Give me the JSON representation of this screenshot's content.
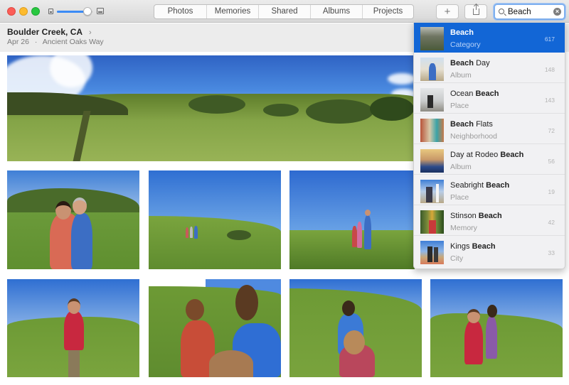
{
  "window": {
    "controls": [
      "close",
      "minimize",
      "maximize"
    ],
    "zoom_slider_value": 0.85
  },
  "toolbar": {
    "tabs": [
      {
        "label": "Photos",
        "active": true
      },
      {
        "label": "Memories",
        "active": false
      },
      {
        "label": "Shared",
        "active": false
      },
      {
        "label": "Albums",
        "active": false
      },
      {
        "label": "Projects",
        "active": false
      }
    ],
    "add_label": "+",
    "add_icon": "plus-icon",
    "share_icon": "share-icon",
    "search": {
      "value": "Beach",
      "icon": "magnifier-icon",
      "clear_icon": "clear-icon",
      "clear_glyph": "×"
    }
  },
  "header": {
    "title": "Boulder Creek, CA",
    "chevron": "›",
    "date": "Apr 26",
    "separator": "·",
    "location": "Ancient Oaks Way"
  },
  "photos": [
    {
      "description": "Panoramic grassy hillside with trail and blue sky"
    },
    {
      "description": "Couple embracing in grassy field"
    },
    {
      "description": "Group of hikers walking up grassy slope"
    },
    {
      "description": "Hikers walking through tall grass"
    },
    {
      "description": "Girl in red vest standing on hillside"
    },
    {
      "description": "Children with backpacks walking uphill"
    },
    {
      "description": "Girls walking up grassy hill"
    },
    {
      "description": "Two girls standing in grassy field"
    }
  ],
  "search_results": [
    {
      "prefix": "",
      "match": "Beach",
      "suffix": "",
      "type": "Category",
      "count": "617",
      "selected": true
    },
    {
      "prefix": "",
      "match": "Beach",
      "suffix": " Day",
      "type": "Album",
      "count": "148",
      "selected": false
    },
    {
      "prefix": "Ocean ",
      "match": "Beach",
      "suffix": "",
      "type": "Place",
      "count": "143",
      "selected": false
    },
    {
      "prefix": "",
      "match": "Beach",
      "suffix": " Flats",
      "type": "Neighborhood",
      "count": "72",
      "selected": false
    },
    {
      "prefix": "Day at Rodeo ",
      "match": "Beach",
      "suffix": "",
      "type": "Album",
      "count": "56",
      "selected": false
    },
    {
      "prefix": "Seabright ",
      "match": "Beach",
      "suffix": "",
      "type": "Place",
      "count": "19",
      "selected": false
    },
    {
      "prefix": "Stinson ",
      "match": "Beach",
      "suffix": "",
      "type": "Memory",
      "count": "42",
      "selected": false
    },
    {
      "prefix": "Kings ",
      "match": "Beach",
      "suffix": "",
      "type": "City",
      "count": "33",
      "selected": false
    }
  ],
  "colors": {
    "accent": "#1266d6",
    "active_tab": "#6a6a6a",
    "sky": "#3f7fd6",
    "grass": "#7ea043"
  }
}
